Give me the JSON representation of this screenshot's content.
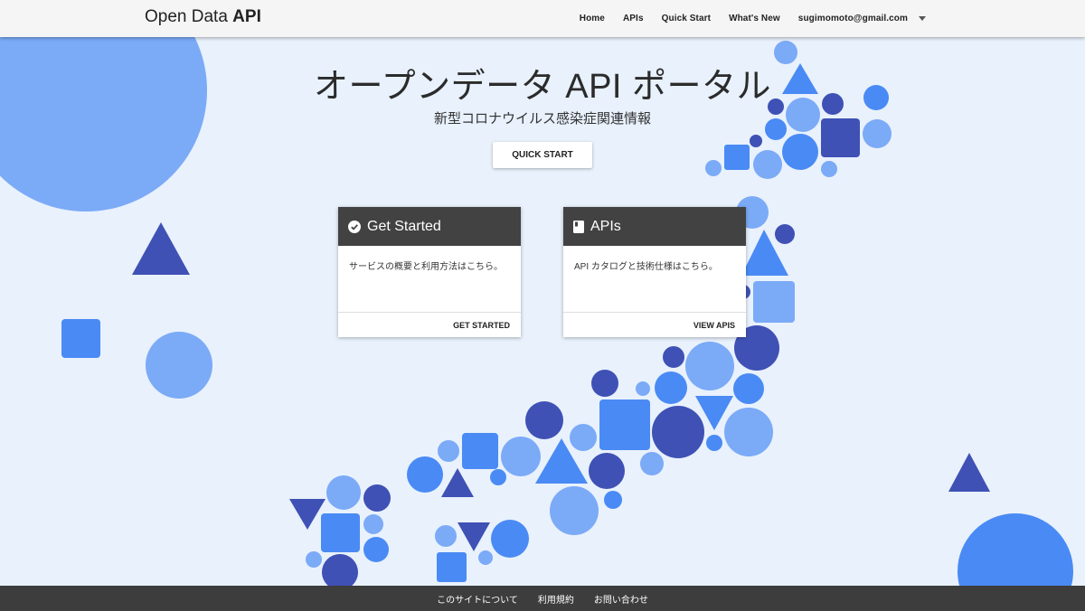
{
  "header": {
    "brand_prefix": "Open Data ",
    "brand_bold": "API",
    "nav": [
      "Home",
      "APIs",
      "Quick Start",
      "What's New"
    ],
    "account_email": "sugimomoto@gmail.com"
  },
  "hero": {
    "title": "オープンデータ API ポータル",
    "subtitle": "新型コロナウイルス感染症関連情報",
    "quick_start_label": "QUICK START"
  },
  "cards": [
    {
      "icon": "check-circle-icon",
      "title": "Get Started",
      "body": "サービスの概要と利用方法はこちら。",
      "action": "GET STARTED"
    },
    {
      "icon": "book-icon",
      "title": "APIs",
      "body": "API カタログと技術仕様はこちら。",
      "action": "VIEW APIS"
    }
  ],
  "footer": {
    "links": [
      "このサイトについて",
      "利用規約",
      "お問い合わせ"
    ]
  },
  "colors": {
    "light_blue": "#7baaf7",
    "mid_blue": "#4a8af4",
    "dark_blue": "#3f51b5",
    "header_bg": "#f5f5f5",
    "card_head_bg": "#424242",
    "footer_bg": "#3d3d3d",
    "page_bg": "#e8f1fc"
  }
}
